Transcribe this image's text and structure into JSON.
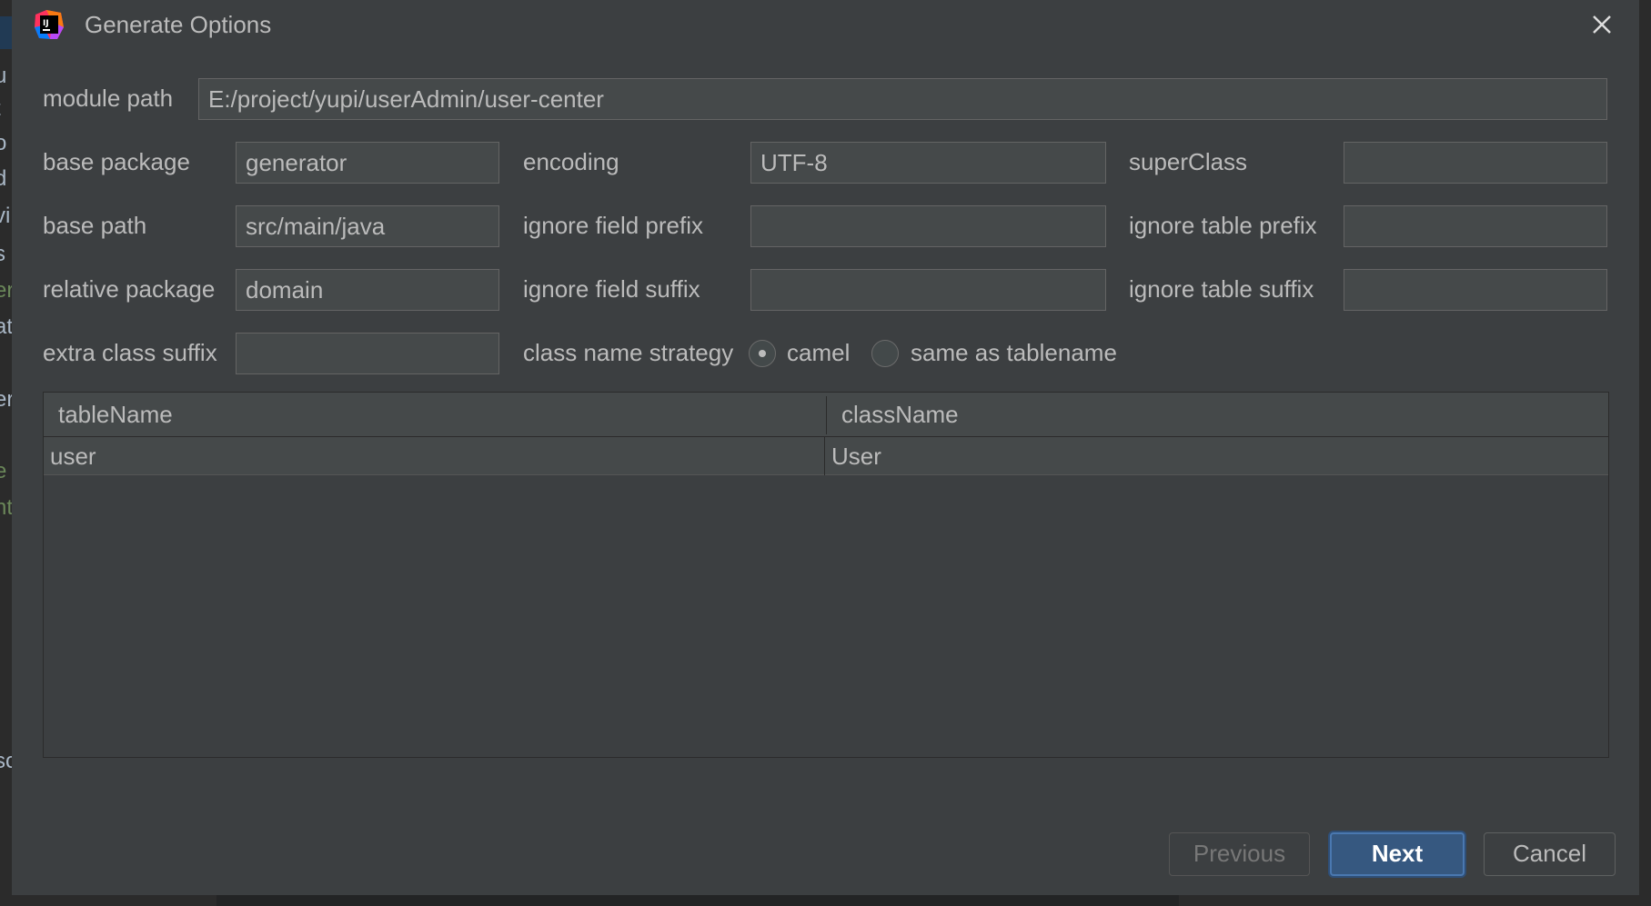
{
  "dialog": {
    "title": "Generate Options"
  },
  "form": {
    "module_path": {
      "label": "module path",
      "value": "E:/project/yupi/userAdmin/user-center"
    },
    "base_package": {
      "label": "base package",
      "value": "generator"
    },
    "encoding": {
      "label": "encoding",
      "value": "UTF-8"
    },
    "super_class": {
      "label": "superClass",
      "value": ""
    },
    "base_path": {
      "label": "base path",
      "value": "src/main/java"
    },
    "ignore_field_prefix": {
      "label": "ignore field prefix",
      "value": ""
    },
    "ignore_table_prefix": {
      "label": "ignore table prefix",
      "value": ""
    },
    "relative_package": {
      "label": "relative package",
      "value": "domain"
    },
    "ignore_field_suffix": {
      "label": "ignore field suffix",
      "value": ""
    },
    "ignore_table_suffix": {
      "label": "ignore table suffix",
      "value": ""
    },
    "extra_class_suffix": {
      "label": "extra class suffix",
      "value": ""
    },
    "class_name_strategy": {
      "label": "class name strategy",
      "options": [
        {
          "label": "camel",
          "selected": true
        },
        {
          "label": "same as tablename",
          "selected": false
        }
      ]
    }
  },
  "table": {
    "columns": [
      "tableName",
      "className"
    ],
    "rows": [
      [
        "user",
        "User"
      ]
    ]
  },
  "buttons": {
    "previous": "Previous",
    "next": "Next",
    "cancel": "Cancel"
  },
  "background": {
    "left_fragments": [
      "u",
      "t",
      "o",
      "d",
      "vi",
      "s",
      "er",
      "at",
      "er",
      "e",
      "nt",
      "sc"
    ]
  },
  "colors": {
    "dialog_bg": "#3c3f41",
    "field_bg": "#45494a",
    "accent_button": "#365880",
    "text": "#bbbbbb"
  }
}
